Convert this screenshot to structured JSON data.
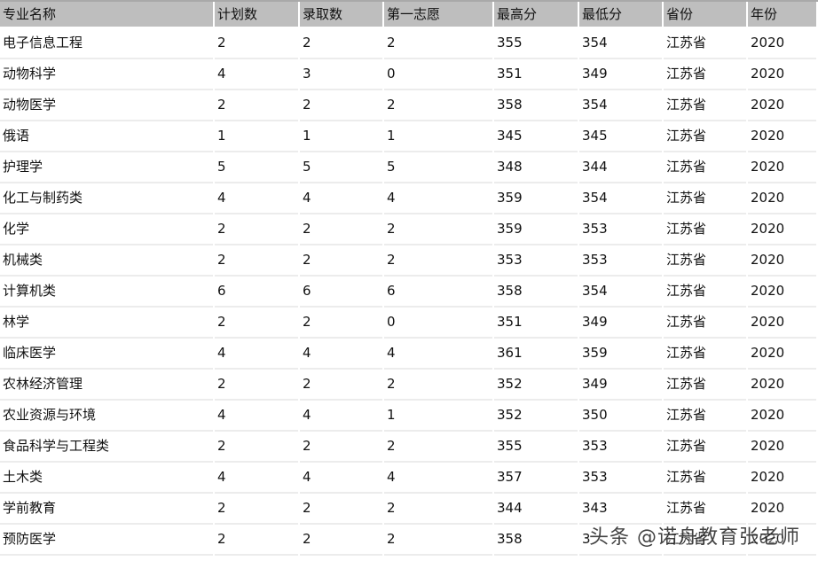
{
  "table": {
    "headers": [
      "专业名称",
      "计划数",
      "录取数",
      "第一志愿",
      "最高分",
      "最低分",
      "省份",
      "年份"
    ],
    "rows": [
      [
        "电子信息工程",
        "2",
        "2",
        "2",
        "355",
        "354",
        "江苏省",
        "2020"
      ],
      [
        "动物科学",
        "4",
        "3",
        "0",
        "351",
        "349",
        "江苏省",
        "2020"
      ],
      [
        "动物医学",
        "2",
        "2",
        "2",
        "358",
        "354",
        "江苏省",
        "2020"
      ],
      [
        "俄语",
        "1",
        "1",
        "1",
        "345",
        "345",
        "江苏省",
        "2020"
      ],
      [
        "护理学",
        "5",
        "5",
        "5",
        "348",
        "344",
        "江苏省",
        "2020"
      ],
      [
        "化工与制药类",
        "4",
        "4",
        "4",
        "359",
        "354",
        "江苏省",
        "2020"
      ],
      [
        "化学",
        "2",
        "2",
        "2",
        "359",
        "353",
        "江苏省",
        "2020"
      ],
      [
        "机械类",
        "2",
        "2",
        "2",
        "353",
        "353",
        "江苏省",
        "2020"
      ],
      [
        "计算机类",
        "6",
        "6",
        "6",
        "358",
        "354",
        "江苏省",
        "2020"
      ],
      [
        "林学",
        "2",
        "2",
        "0",
        "351",
        "349",
        "江苏省",
        "2020"
      ],
      [
        "临床医学",
        "4",
        "4",
        "4",
        "361",
        "359",
        "江苏省",
        "2020"
      ],
      [
        "农林经济管理",
        "2",
        "2",
        "2",
        "352",
        "349",
        "江苏省",
        "2020"
      ],
      [
        "农业资源与环境",
        "4",
        "4",
        "1",
        "352",
        "350",
        "江苏省",
        "2020"
      ],
      [
        "食品科学与工程类",
        "2",
        "2",
        "2",
        "355",
        "353",
        "江苏省",
        "2020"
      ],
      [
        "土木类",
        "4",
        "4",
        "4",
        "357",
        "353",
        "江苏省",
        "2020"
      ],
      [
        "学前教育",
        "2",
        "2",
        "2",
        "344",
        "343",
        "江苏省",
        "2020"
      ],
      [
        "预防医学",
        "2",
        "2",
        "2",
        "358",
        "3",
        "江苏省",
        "2020"
      ]
    ]
  },
  "watermark": "头条 @诺舟教育张老师"
}
